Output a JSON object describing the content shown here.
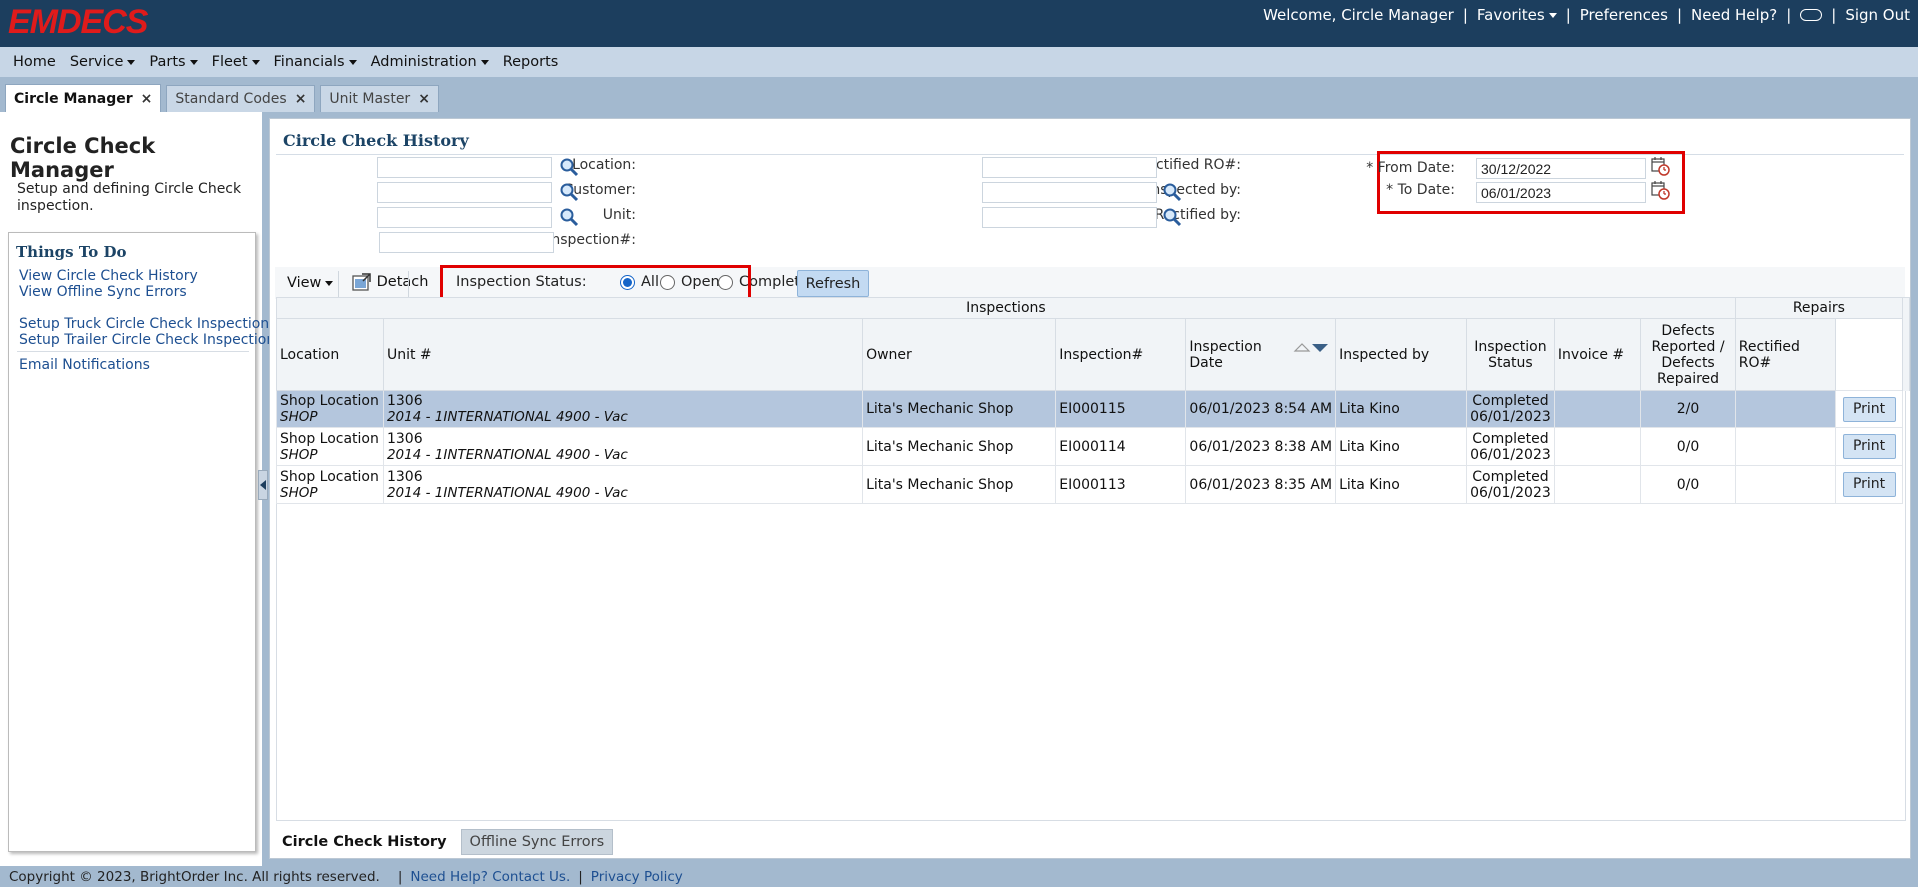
{
  "app": {
    "logo_text": "EMDECS",
    "welcome": "Welcome, Circle Manager",
    "favorites": "Favorites",
    "preferences": "Preferences",
    "need_help": "Need Help?",
    "sign_out": "Sign Out"
  },
  "menu": [
    "Home",
    "Service",
    "Parts",
    "Fleet",
    "Financials",
    "Administration",
    "Reports"
  ],
  "tabs": [
    {
      "label": "Circle Manager",
      "active": true
    },
    {
      "label": "Standard Codes",
      "active": false
    },
    {
      "label": "Unit Master",
      "active": false
    }
  ],
  "left": {
    "title": "Circle Check Manager",
    "description": "Setup and defining Circle Check inspection.",
    "todo_title": "Things To Do",
    "links": [
      "View Circle Check History",
      "View Offline Sync Errors",
      "Setup Truck Circle Check Inspection",
      "Setup Trailer Circle Check Inspection",
      "Email Notifications"
    ]
  },
  "main": {
    "title": "Circle Check History",
    "filters": {
      "location_label": "Location:",
      "customer_label": "Customer:",
      "unit_label": "Unit:",
      "inspection_no_label": "Inspection#:",
      "rectified_ro_label": "Rectified RO#:",
      "inspected_by_label": "Inspected by:",
      "rectified_by_label": "Rectified by:",
      "from_date_label": "* From Date:",
      "from_date_value": "30/12/2022",
      "to_date_label": "* To Date:",
      "to_date_value": "06/01/2023"
    },
    "toolbar": {
      "view": "View",
      "detach": "Detach",
      "status_label": "Inspection Status:",
      "status_options": [
        "All",
        "Open",
        "Completed"
      ],
      "status_selected": "All",
      "refresh": "Refresh"
    },
    "grid": {
      "group_inspections": "Inspections",
      "group_repairs": "Repairs",
      "columns": [
        "Location",
        "Unit #",
        "Owner",
        "Inspection#",
        "Inspection Date",
        "Inspected by",
        "Inspection Status",
        "Invoice #",
        "Defects Reported / Defects Repaired",
        "Rectified RO#"
      ],
      "print_label": "Print",
      "rows": [
        {
          "location": "Shop Location",
          "location_code": "SHOP",
          "unit": "1306",
          "unit_desc": "2014 - 1INTERNATIONAL 4900 - Vac",
          "owner": "Lita's Mechanic Shop",
          "inspection_no": "EI000115",
          "date": "06/01/2023 8:54 AM",
          "inspected_by": "Lita Kino",
          "status": "Completed",
          "status_date": "06/01/2023",
          "invoice": "",
          "defects": "2/0",
          "rectified_ro": "",
          "selected": true
        },
        {
          "location": "Shop Location",
          "location_code": "SHOP",
          "unit": "1306",
          "unit_desc": "2014 - 1INTERNATIONAL 4900 - Vac",
          "owner": "Lita's Mechanic Shop",
          "inspection_no": "EI000114",
          "date": "06/01/2023 8:38 AM",
          "inspected_by": "Lita Kino",
          "status": "Completed",
          "status_date": "06/01/2023",
          "invoice": "",
          "defects": "0/0",
          "rectified_ro": "",
          "selected": false
        },
        {
          "location": "Shop Location",
          "location_code": "SHOP",
          "unit": "1306",
          "unit_desc": "2014 - 1INTERNATIONAL 4900 - Vac",
          "owner": "Lita's Mechanic Shop",
          "inspection_no": "EI000113",
          "date": "06/01/2023 8:35 AM",
          "inspected_by": "Lita Kino",
          "status": "Completed",
          "status_date": "06/01/2023",
          "invoice": "",
          "defects": "0/0",
          "rectified_ro": "",
          "selected": false
        }
      ]
    },
    "bottom_tabs": [
      "Circle Check History",
      "Offline Sync Errors"
    ]
  },
  "footer": {
    "copyright": "Copyright © 2023, BrightOrder Inc. All rights reserved.",
    "help_link": "Need Help? Contact Us.",
    "privacy_link": "Privacy Policy"
  },
  "colors": {
    "topbar": "#1c3e5e",
    "logo": "#e01b1b",
    "highlight_box": "#e00000",
    "selected_row": "#b4c6dd"
  }
}
